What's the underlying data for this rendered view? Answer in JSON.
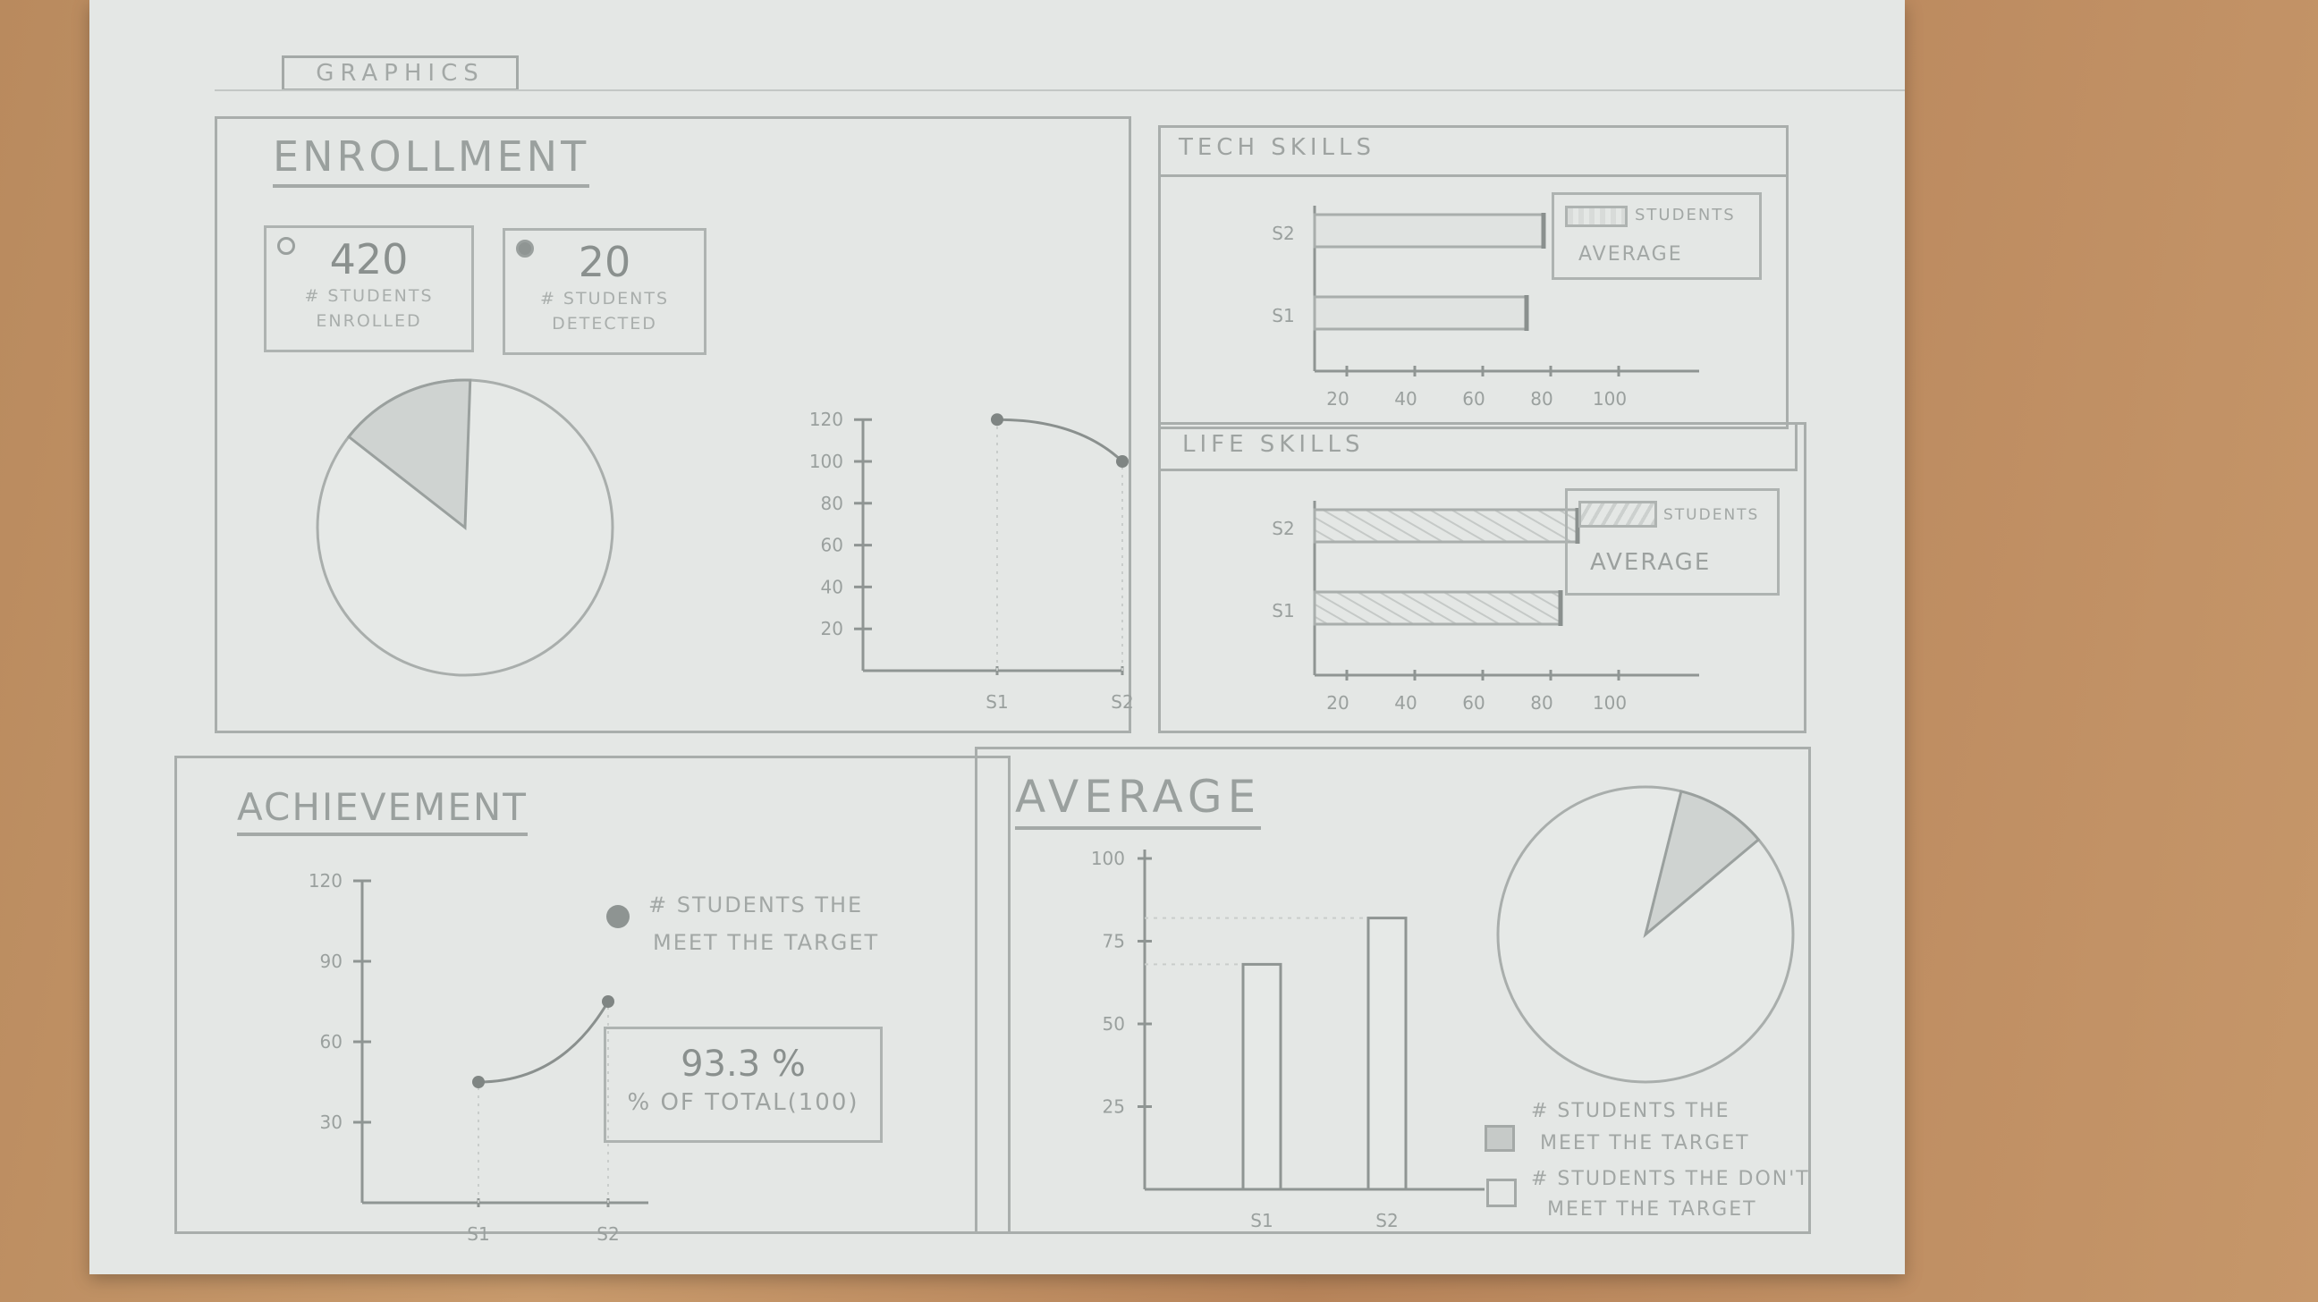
{
  "graphics_label": "GRAPHICS",
  "enrollment": {
    "title": "ENROLLMENT",
    "kpi_enrolled": {
      "value": "420",
      "label_line1": "# STUDENTS",
      "label_line2": "ENROLLED"
    },
    "kpi_detected": {
      "value": "20",
      "label_line1": "# STUDENTS",
      "label_line2": "DETECTED"
    },
    "pie_fraction": 0.15,
    "line_chart": {
      "type": "line",
      "categories": [
        "S1",
        "S2"
      ],
      "values": [
        120,
        100
      ],
      "yticks": [
        "120",
        "100",
        "80",
        "60",
        "40",
        "20"
      ],
      "ylim": [
        0,
        120
      ]
    }
  },
  "tech_skills": {
    "title": "TECH SKILLS",
    "chart_data": {
      "type": "bar",
      "categories": [
        "S2",
        "S1"
      ],
      "values": [
        70,
        65
      ],
      "xticks": [
        "20",
        "40",
        "60",
        "80",
        "100"
      ],
      "xlim": [
        0,
        100
      ]
    },
    "legend_line1": "STUDENTS",
    "legend_line2": "AVERAGE"
  },
  "life_skills": {
    "title": "LIFE SKILLS",
    "chart_data": {
      "type": "bar",
      "categories": [
        "S2",
        "S1"
      ],
      "values": [
        80,
        75
      ],
      "xticks": [
        "20",
        "40",
        "60",
        "80",
        "100"
      ],
      "xlim": [
        0,
        100
      ]
    },
    "legend_line1": "STUDENTS",
    "legend_line2": "AVERAGE"
  },
  "achievement": {
    "title": "ACHIEVEMENT",
    "line_chart": {
      "type": "line",
      "categories": [
        "S1",
        "S2"
      ],
      "values": [
        45,
        75
      ],
      "yticks": [
        "120",
        "90",
        "60",
        "30"
      ],
      "ylim": [
        0,
        120
      ]
    },
    "legend_line1": "# STUDENTS THE",
    "legend_line2": "MEET THE TARGET",
    "percent_value": "93.3 %",
    "percent_label": "% OF TOTAL(100)"
  },
  "average": {
    "title": "AVERAGE",
    "bar_chart": {
      "type": "bar",
      "categories": [
        "S1",
        "S2"
      ],
      "values": [
        68,
        82
      ],
      "yticks": [
        "100",
        "75",
        "50",
        "25"
      ],
      "ylim": [
        0,
        100
      ]
    },
    "pie_fraction": 0.1,
    "legend_meet_line1": "# STUDENTS THE",
    "legend_meet_line2": "MEET THE TARGET",
    "legend_not_line1": "# STUDENTS THE DON'T",
    "legend_not_line2": "MEET THE TARGET"
  }
}
